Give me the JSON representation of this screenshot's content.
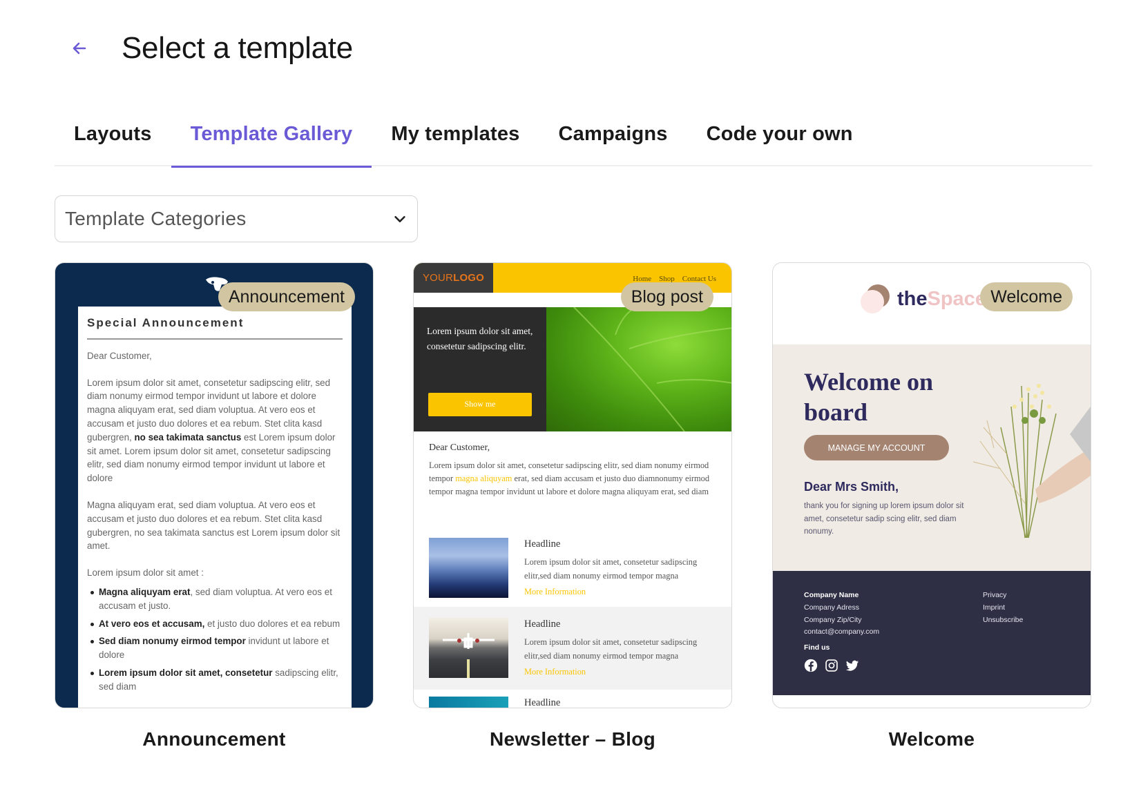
{
  "header": {
    "title": "Select a template",
    "back_icon": "arrow-left-icon"
  },
  "tabs": [
    {
      "label": "Layouts",
      "active": false
    },
    {
      "label": "Template Gallery",
      "active": true
    },
    {
      "label": "My templates",
      "active": false
    },
    {
      "label": "Campaigns",
      "active": false
    },
    {
      "label": "Code your own",
      "active": false
    }
  ],
  "colors": {
    "accent": "#6a5ad6",
    "badge": "#d2c6a2"
  },
  "category_select": {
    "value": "Template Categories",
    "icon": "chevron-down-icon"
  },
  "templates": [
    {
      "name": "Announcement",
      "badge": "Announcement",
      "preview": {
        "heading": "Special Announcement",
        "greeting": "Dear Customer,",
        "p1_a": "Lorem ipsum dolor sit amet, consetetur sadipscing elitr, sed diam nonumy eirmod tempor invidunt ut labore et dolore magna aliquyam erat, sed diam voluptua. At vero eos et accusam et justo duo dolores et ea rebum. Stet clita kasd gubergren, ",
        "p1_bold": "no sea takimata sanctus",
        "p1_b": " est Lorem ipsum dolor sit amet. Lorem ipsum dolor sit amet, consetetur sadipscing elitr, sed diam nonumy eirmod tempor invidunt ut labore et dolore",
        "p2": "Magna aliquyam erat, sed diam voluptua. At vero eos et accusam et justo duo dolores et ea rebum. Stet clita kasd gubergren, no sea takimata sanctus est Lorem ipsum dolor sit amet.",
        "p3": "Lorem ipsum dolor sit amet :",
        "list": [
          {
            "bold": "Magna aliquyam erat",
            "rest": ", sed diam voluptua. At vero eos et accusam et justo."
          },
          {
            "bold": "At vero eos et accusam,",
            "rest": " et justo duo dolores et ea rebum"
          },
          {
            "bold": "Sed diam nonumy eirmod tempor",
            "rest": " invidunt ut labore et dolore"
          },
          {
            "bold": "Lorem ipsum dolor sit amet, consetetur",
            "rest": " sadipscing elitr, sed diam"
          }
        ]
      }
    },
    {
      "name": "Newsletter – Blog",
      "badge": "Blog post",
      "preview": {
        "logo_light": "YOUR",
        "logo_bold": "LOGO",
        "nav": [
          "Home",
          "Shop",
          "Contact Us"
        ],
        "hero_text": "Lorem ipsum dolor sit amet, consetetur sadipscing elitr.",
        "hero_button": "Show me",
        "greeting": "Dear Customer,",
        "body_a": "Lorem ipsum dolor sit amet, consetetur sadipscing elitr, sed diam nonumy eirmod tempor ",
        "body_highlight": "magna aliquyam",
        "body_b": " erat, sed diam accusam et justo duo diamnonumy eirmod tempor magna tempor invidunt ut labore et dolore magna aliquyam erat, sed diam",
        "items": [
          {
            "headline": "Headline",
            "text": "Lorem ipsum dolor sit amet, consetetur sadipscing elitr,sed diam nonumy eirmod tempor magna",
            "link": "More Information",
            "image": "mountains"
          },
          {
            "headline": "Headline",
            "text": "Lorem ipsum dolor sit amet, consetetur sadipscing elitr,sed diam nonumy eirmod tempor magna",
            "link": "More Information",
            "image": "airplane"
          },
          {
            "headline": "Headline",
            "text": "",
            "link": "",
            "image": "ocean"
          }
        ]
      }
    },
    {
      "name": "Welcome",
      "badge": "Welcome",
      "preview": {
        "brand_a": "the",
        "brand_b": "Space",
        "title": "Welcome on board",
        "button": "MANAGE MY ACCOUNT",
        "greeting": "Dear Mrs Smith,",
        "text": "thank you for signing up lorem ipsum dolor sit amet, consetetur sadip scing elitr, sed diam nonumy.",
        "footer_left": [
          "Company Name",
          "Company Adress",
          "Company Zip/City",
          "contact@company.com"
        ],
        "footer_right": [
          "Privacy",
          "Imprint",
          "Unsubscribe"
        ],
        "find_us": "Find us",
        "social": [
          "facebook-icon",
          "instagram-icon",
          "twitter-icon"
        ]
      }
    }
  ]
}
